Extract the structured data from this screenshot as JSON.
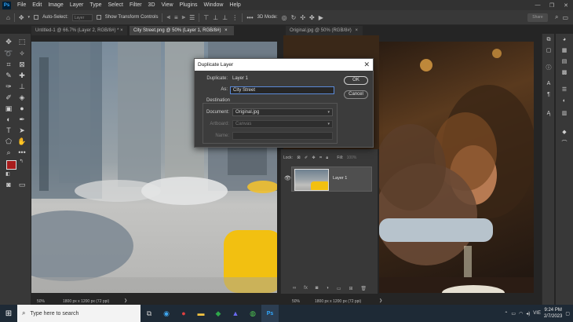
{
  "app": {
    "logo": "Ps"
  },
  "menu": [
    "File",
    "Edit",
    "Image",
    "Layer",
    "Type",
    "Select",
    "Filter",
    "3D",
    "View",
    "Plugins",
    "Window",
    "Help"
  ],
  "window_controls": {
    "minimize": "—",
    "restore": "❐",
    "close": "✕"
  },
  "options_bar": {
    "auto_select_label": "Auto-Select:",
    "auto_select_value": "Layer",
    "transform_controls_label": "Show Transform Controls",
    "mode_label": "3D Mode:",
    "share_label": "Share"
  },
  "tabs": [
    {
      "label": "Untitled-1 @ 66.7% (Layer 2, RGB/8#) *",
      "close": "×"
    },
    {
      "label": "City Street.png @ 50% (Layer 1, RGB/8#)",
      "close": "×"
    },
    {
      "label": "Original.jpg @ 50% (RGB/8#)",
      "close": "×"
    }
  ],
  "status_left": {
    "zoom": "50%",
    "size": "1800 px x 1200 px (72 ppi)"
  },
  "status_right": {
    "zoom": "50%",
    "size": "1800 px x 1200 px (72 ppi)"
  },
  "layers_panel": {
    "lock_label": "Lock:",
    "fill_label": "Fill:",
    "fill_value": "100%",
    "layer_name": "Layer 1"
  },
  "dialog": {
    "title": "Duplicate Layer",
    "duplicate_label": "Duplicate:",
    "duplicate_value": "Layer 1",
    "as_label": "As:",
    "as_value": "City Street",
    "destination_label": "Destination",
    "document_label": "Document:",
    "document_value": "Original.jpg",
    "artboard_label": "Artboard:",
    "artboard_value": "Canvas",
    "name_label": "Name:",
    "ok_label": "OK",
    "cancel_label": "Cancel"
  },
  "taskbar": {
    "search_placeholder": "Type here to search",
    "language": "VIE",
    "time": "9:24 PM",
    "date": "2/7/2023"
  },
  "colors": {
    "foreground": "#a81c1c",
    "background": "#ffffff",
    "accent": "#5b8ad8"
  }
}
